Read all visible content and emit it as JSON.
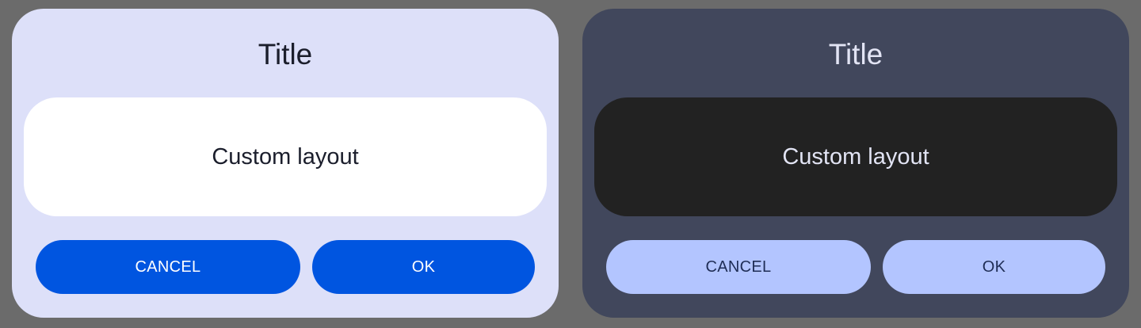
{
  "colors": {
    "backdrop": "#6b6b6b",
    "light_surface": "#dde0f9",
    "light_content": "#ffffff",
    "light_button": "#0055e0",
    "dark_surface": "#41475c",
    "dark_content": "#222222",
    "dark_button": "#b3c5ff"
  },
  "dialogs": [
    {
      "theme": "light",
      "title": "Title",
      "content": "Custom layout",
      "cancel_label": "CANCEL",
      "ok_label": "OK"
    },
    {
      "theme": "dark",
      "title": "Title",
      "content": "Custom layout",
      "cancel_label": "CANCEL",
      "ok_label": "OK"
    }
  ]
}
